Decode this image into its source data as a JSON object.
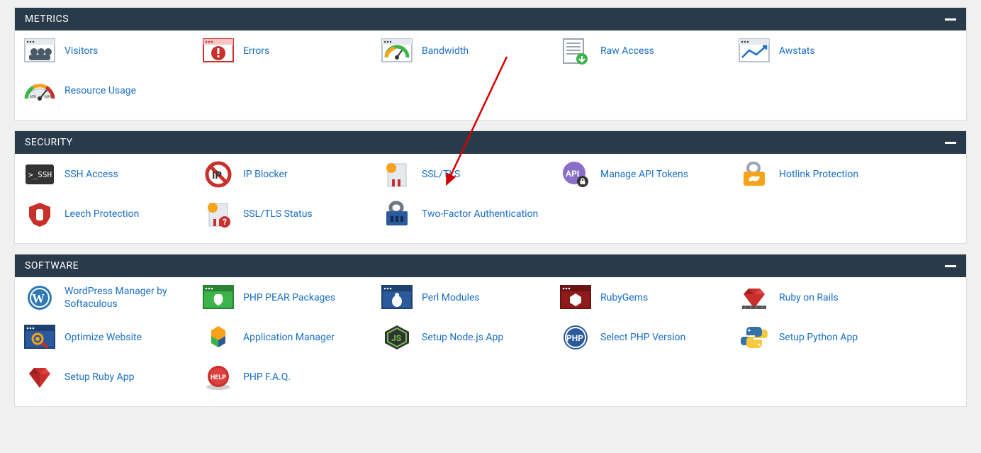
{
  "panels": [
    {
      "id": "metrics",
      "title": "METRICS",
      "items": [
        {
          "id": "visitors",
          "label": "Visitors"
        },
        {
          "id": "errors",
          "label": "Errors"
        },
        {
          "id": "bandwidth",
          "label": "Bandwidth"
        },
        {
          "id": "raw-access",
          "label": "Raw Access"
        },
        {
          "id": "awstats",
          "label": "Awstats"
        },
        {
          "id": "resource-usage",
          "label": "Resource Usage"
        }
      ]
    },
    {
      "id": "security",
      "title": "SECURITY",
      "items": [
        {
          "id": "ssh-access",
          "label": "SSH Access"
        },
        {
          "id": "ip-blocker",
          "label": "IP Blocker"
        },
        {
          "id": "ssl-tls",
          "label": "SSL/TLS"
        },
        {
          "id": "manage-api-tokens",
          "label": "Manage API Tokens"
        },
        {
          "id": "hotlink-protection",
          "label": "Hotlink Protection"
        },
        {
          "id": "leech-protection",
          "label": "Leech Protection"
        },
        {
          "id": "ssl-tls-status",
          "label": "SSL/TLS Status"
        },
        {
          "id": "two-factor-auth",
          "label": "Two-Factor Authentication"
        }
      ]
    },
    {
      "id": "software",
      "title": "SOFTWARE",
      "items": [
        {
          "id": "wordpress-manager",
          "label": "WordPress Manager by Softaculous"
        },
        {
          "id": "php-pear",
          "label": "PHP PEAR Packages"
        },
        {
          "id": "perl-modules",
          "label": "Perl Modules"
        },
        {
          "id": "rubygems",
          "label": "RubyGems"
        },
        {
          "id": "ruby-on-rails",
          "label": "Ruby on Rails"
        },
        {
          "id": "optimize-website",
          "label": "Optimize Website"
        },
        {
          "id": "application-manager",
          "label": "Application Manager"
        },
        {
          "id": "setup-nodejs",
          "label": "Setup Node.js App"
        },
        {
          "id": "select-php",
          "label": "Select PHP Version"
        },
        {
          "id": "setup-python",
          "label": "Setup Python App"
        },
        {
          "id": "setup-ruby",
          "label": "Setup Ruby App"
        },
        {
          "id": "php-faq",
          "label": "PHP F.A.Q."
        }
      ]
    }
  ]
}
